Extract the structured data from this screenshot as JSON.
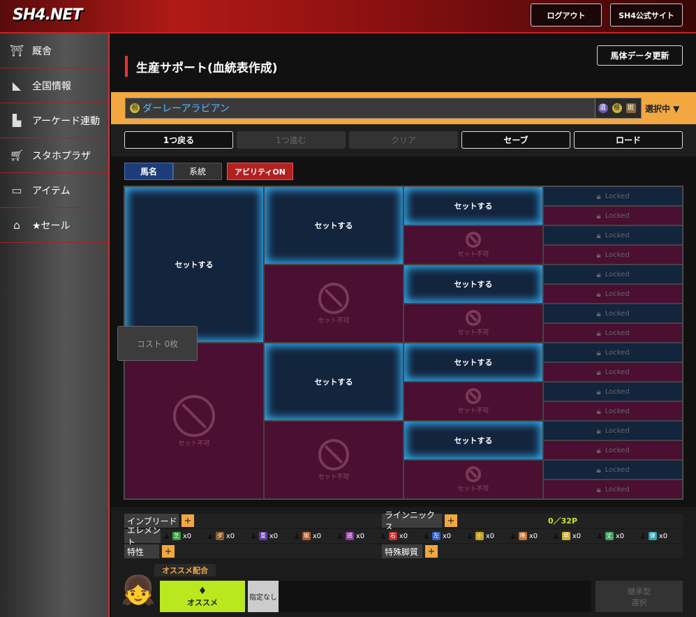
{
  "header": {
    "logo": "SH4.NET",
    "logout": "ログアウト",
    "official": "SH4公式サイト"
  },
  "sidebar": {
    "items": [
      {
        "label": "厩舎",
        "icon": "stable-icon"
      },
      {
        "label": "全国情報",
        "icon": "japan-map-icon"
      },
      {
        "label": "アーケード連動",
        "icon": "arcade-icon"
      },
      {
        "label": "スタホプラザ",
        "icon": "cart-icon"
      },
      {
        "label": "アイテム",
        "icon": "ticket-icon"
      },
      {
        "label": "★セール",
        "icon": "bank-icon"
      }
    ]
  },
  "page": {
    "title": "生産サポート(血統表作成)",
    "update_button": "馬体データ更新"
  },
  "selection": {
    "horse": "ダーレーアラビアン",
    "badge": "祖",
    "tags": [
      "遺",
      "根",
      "斑"
    ],
    "status": "選択中 ▼"
  },
  "toolbar": {
    "back": "1つ戻る",
    "forward": "1つ進む",
    "clear": "クリア",
    "save": "セーブ",
    "load": "ロード"
  },
  "tabs": {
    "name": "馬名",
    "lineage": "系統",
    "ability": "アビリティON"
  },
  "grid": {
    "set": "セットする",
    "ng": "セット不可",
    "locked": "Locked",
    "cost": "コスト 0枚"
  },
  "bottom": {
    "inbreed": "インブリード",
    "nicks": "ラインニックス",
    "points": "0／32P",
    "element": "エレメント",
    "trait": "特性",
    "special": "特殊脚質",
    "elements": [
      {
        "c": "芝",
        "v": "x0",
        "col": "#3a9a3a"
      },
      {
        "c": "ダ",
        "v": "x0",
        "col": "#8a5a2a"
      },
      {
        "c": "重",
        "v": "x0",
        "col": "#5a3aa0"
      },
      {
        "c": "坂",
        "v": "x0",
        "col": "#b05a2a"
      },
      {
        "c": "逃",
        "v": "x0",
        "col": "#8a3aa0"
      },
      {
        "c": "右",
        "v": "x0",
        "col": "#c03030"
      },
      {
        "c": "左",
        "v": "x0",
        "col": "#3060c0"
      },
      {
        "c": "小",
        "v": "x0",
        "col": "#c0a020"
      },
      {
        "c": "晩",
        "v": "x0",
        "col": "#c07030"
      },
      {
        "c": "早",
        "v": "x0",
        "col": "#d0b030"
      },
      {
        "c": "丈",
        "v": "x0",
        "col": "#40a060"
      },
      {
        "c": "健",
        "v": "x0",
        "col": "#2aa0b0"
      }
    ],
    "recommend_tab": "オススメ配合",
    "recommend": "オススメ",
    "unspecified": "指定なし",
    "inherit": "継承型\n選択"
  }
}
